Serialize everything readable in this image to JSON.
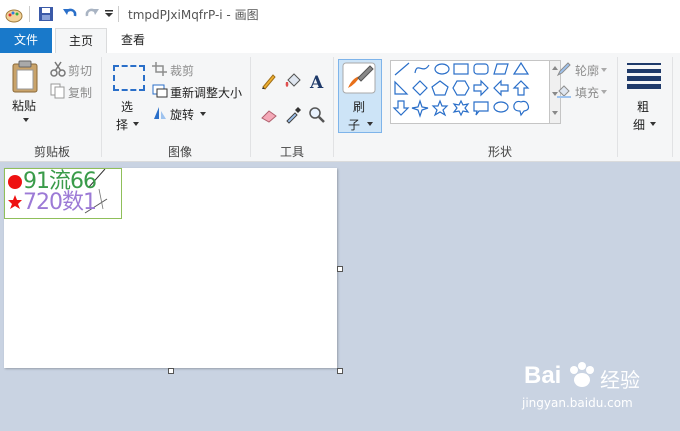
{
  "title": {
    "text": "tmpdPJxiMqfrP-i - 画图"
  },
  "tabs": {
    "file": "文件",
    "home": "主页",
    "view": "查看"
  },
  "clipboard": {
    "paste": "粘贴",
    "cut": "剪切",
    "copy": "复制",
    "group": "剪贴板"
  },
  "image": {
    "select_line1": "选",
    "select_line2": "择",
    "crop": "裁剪",
    "resize": "重新调整大小",
    "rotate": "旋转",
    "group": "图像"
  },
  "tools": {
    "group": "工具"
  },
  "brush": {
    "line1": "刷",
    "line2": "子"
  },
  "shapes": {
    "outline": "轮廓",
    "fill": "填充",
    "group": "形状"
  },
  "size": {
    "line1": "粗",
    "line2": "细"
  },
  "canvas_content": {
    "row1": "91流66",
    "row2": "720数1"
  },
  "watermark": {
    "brand": "Bai",
    "brand2": "经验",
    "url": "jingyan.baidu.com"
  },
  "colors": {
    "accent": "#1979ca",
    "workspace": "#c9d3e2",
    "selected_tool": "#cde4f7"
  }
}
